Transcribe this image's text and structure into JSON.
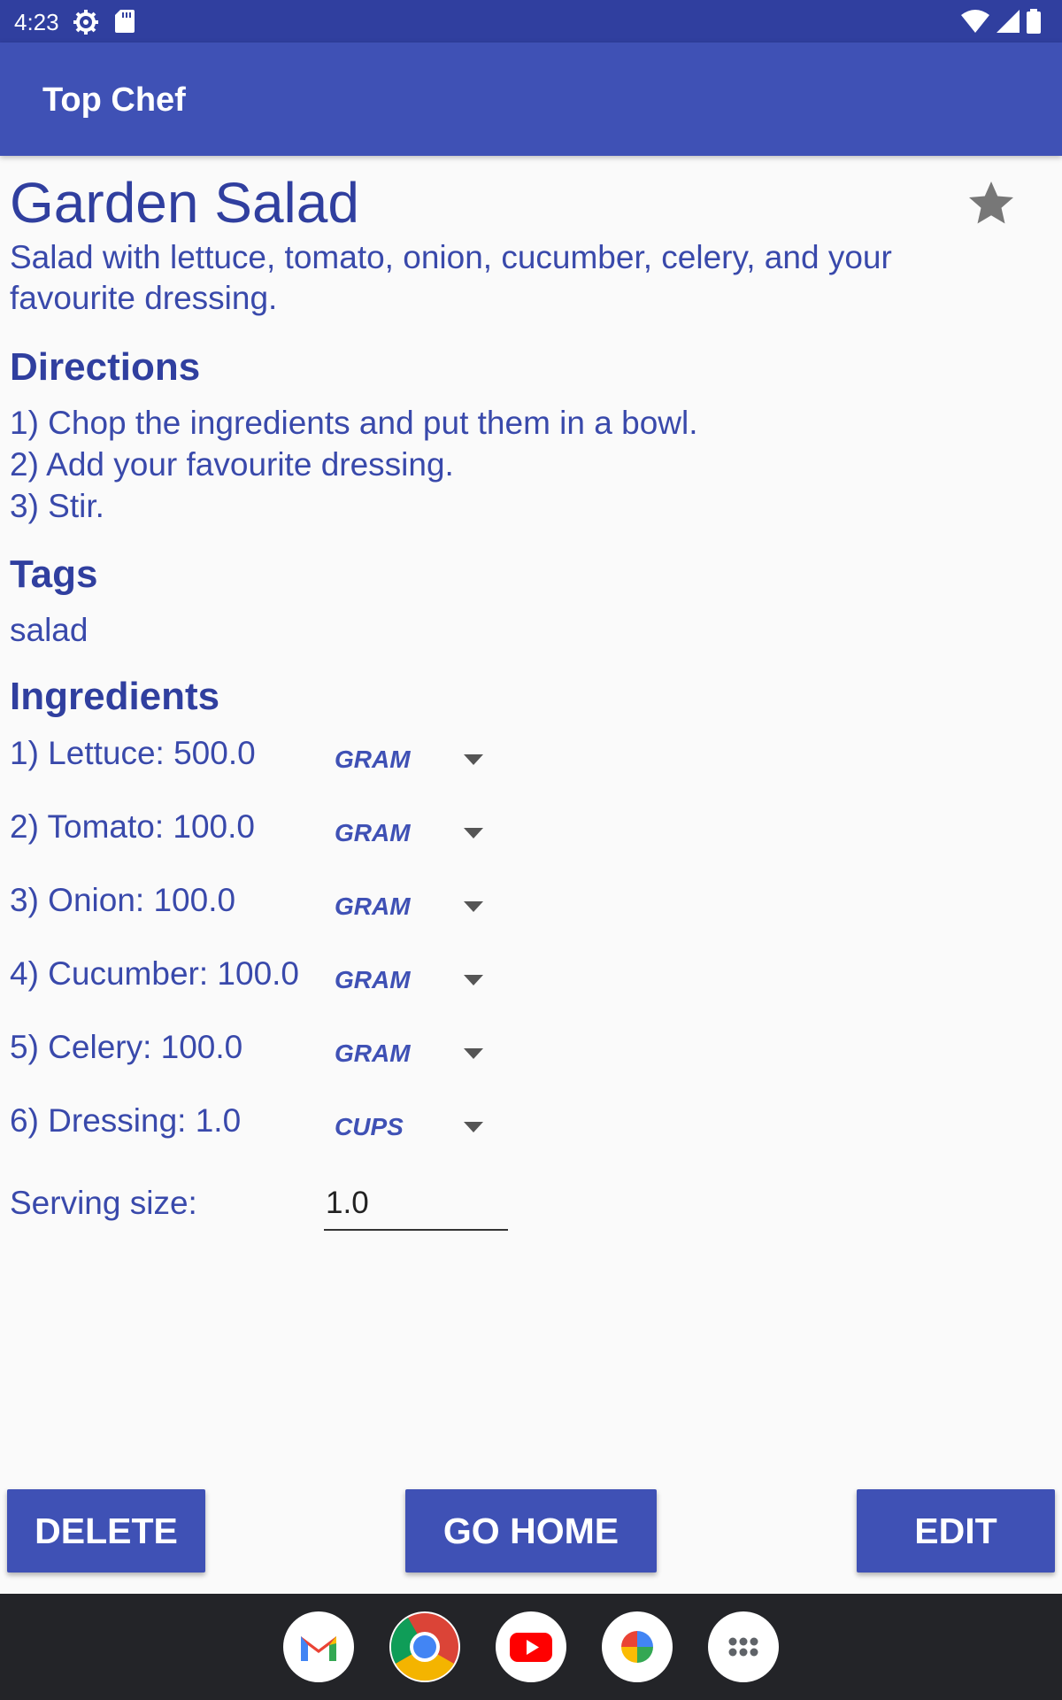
{
  "status_bar": {
    "time": "4:23"
  },
  "app_bar": {
    "title": "Top Chef"
  },
  "recipe": {
    "title": "Garden Salad",
    "description": "Salad with lettuce, tomato, onion, cucumber, celery, and your favourite dressing.",
    "directions_heading": "Directions",
    "directions": [
      "1) Chop the ingredients and put them in a bowl.",
      "2) Add your favourite dressing.",
      "3) Stir."
    ],
    "tags_heading": "Tags",
    "tags": "salad",
    "ingredients_heading": "Ingredients",
    "ingredients": [
      {
        "label": "1) Lettuce: 500.0",
        "unit": "GRAM"
      },
      {
        "label": "2) Tomato: 100.0",
        "unit": "GRAM"
      },
      {
        "label": "3) Onion: 100.0",
        "unit": "GRAM"
      },
      {
        "label": "4) Cucumber: 100.0",
        "unit": "GRAM"
      },
      {
        "label": "5) Celery: 100.0",
        "unit": "GRAM"
      },
      {
        "label": "6) Dressing: 1.0",
        "unit": "CUPS"
      }
    ],
    "serving_label": "Serving size:",
    "serving_value": "1.0"
  },
  "buttons": {
    "delete": "DELETE",
    "go_home": "GO HOME",
    "edit": "EDIT"
  },
  "icons": {
    "favorite": "star-icon",
    "dock": [
      "gmail-icon",
      "chrome-icon",
      "youtube-icon",
      "photos-icon",
      "app-drawer-icon"
    ]
  },
  "colors": {
    "primary": "#3f51b5",
    "primary_dark": "#303f9f",
    "text": "#3949ab"
  }
}
